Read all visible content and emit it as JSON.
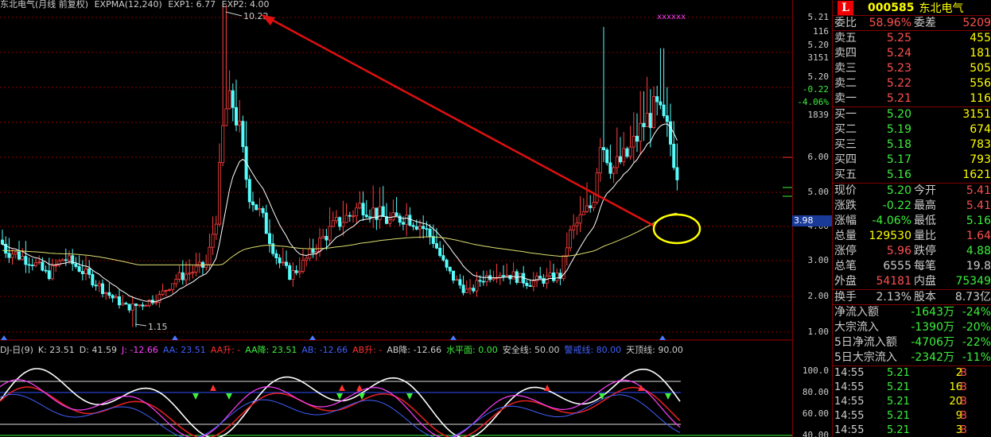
{
  "chart_header": {
    "stock": "东北电气(月线 前复权)",
    "expma": "EXPMA(12,240)",
    "exp1": "EXP1: 6.77",
    "exp2": "EXP2: 4.00"
  },
  "annotations": {
    "high_label": "10.22",
    "low_label": "1.15"
  },
  "indicator_legend": [
    {
      "text": "DJ-日(9)",
      "color": "#cccccc"
    },
    {
      "text": "K: 23.51",
      "color": "#cccccc"
    },
    {
      "text": "D: 41.59",
      "color": "#cccccc"
    },
    {
      "text": "J: -12.66",
      "color": "#ff40ff"
    },
    {
      "text": "AA: 23.51",
      "color": "#4060ff"
    },
    {
      "text": "AA升: -",
      "color": "#ff3030"
    },
    {
      "text": "AA降: 23.51",
      "color": "#3cf03c"
    },
    {
      "text": "AB: -12.66",
      "color": "#4060ff"
    },
    {
      "text": "AB升: -",
      "color": "#ff3030"
    },
    {
      "text": "AB降: -12.66",
      "color": "#cccccc"
    },
    {
      "text": "水平面: 0.00",
      "color": "#3cf03c"
    },
    {
      "text": "安全线: 50.00",
      "color": "#cccccc"
    },
    {
      "text": "警戒线: 80.00",
      "color": "#4060ff"
    },
    {
      "text": "天顶线: 90.00",
      "color": "#cccccc"
    }
  ],
  "price_axis": {
    "ticks": [
      "6.00",
      "5.00",
      "4.00",
      "3.00",
      "2.00",
      "1.00"
    ],
    "ind_ticks": [
      "100.0",
      "80.00",
      "60.00",
      "40.00"
    ],
    "current": "3.98",
    "top_info": [
      "5.21",
      "116",
      "5.20",
      "3151",
      "5.20",
      "-0.22",
      "-4.06%",
      "1839"
    ]
  },
  "quote": {
    "logo": "L",
    "code": "000585",
    "name": "东北电气",
    "weibi": {
      "label": "委比",
      "value": "58.96%",
      "label2": "委差",
      "value2": "5209"
    },
    "asks": [
      {
        "label": "卖五",
        "price": "5.25",
        "vol": "455"
      },
      {
        "label": "卖四",
        "price": "5.24",
        "vol": "181"
      },
      {
        "label": "卖三",
        "price": "5.23",
        "vol": "505"
      },
      {
        "label": "卖二",
        "price": "5.22",
        "vol": "556"
      },
      {
        "label": "卖一",
        "price": "5.21",
        "vol": "116"
      }
    ],
    "bids": [
      {
        "label": "买一",
        "price": "5.20",
        "vol": "3151"
      },
      {
        "label": "买二",
        "price": "5.19",
        "vol": "674"
      },
      {
        "label": "买三",
        "price": "5.18",
        "vol": "783"
      },
      {
        "label": "买四",
        "price": "5.17",
        "vol": "793"
      },
      {
        "label": "买五",
        "price": "5.16",
        "vol": "1621"
      }
    ],
    "stats": [
      {
        "l": "现价",
        "v": "5.20",
        "vc": "green",
        "l2": "今开",
        "v2": "5.41",
        "v2c": "red"
      },
      {
        "l": "涨跌",
        "v": "-0.22",
        "vc": "green",
        "l2": "最高",
        "v2": "5.41",
        "v2c": "red"
      },
      {
        "l": "涨幅",
        "v": "-4.06%",
        "vc": "green",
        "l2": "最低",
        "v2": "5.16",
        "v2c": "green"
      },
      {
        "l": "总量",
        "v": "129530",
        "vc": "yellow",
        "l2": "量比",
        "v2": "1.64",
        "v2c": "red"
      },
      {
        "l": "涨停",
        "v": "5.96",
        "vc": "red",
        "l2": "跌停",
        "v2": "4.88",
        "v2c": "green"
      },
      {
        "l": "总笔",
        "v": "6555",
        "vc": "white",
        "l2": "每笔",
        "v2": "19.8",
        "v2c": "white"
      },
      {
        "l": "外盘",
        "v": "54181",
        "vc": "red",
        "l2": "内盘",
        "v2": "75349",
        "v2c": "green"
      }
    ],
    "turnover": {
      "l": "换手",
      "v": "2.13%",
      "l2": "股本",
      "v2": "8.73亿"
    },
    "flows": [
      {
        "l": "净流入额",
        "v": "-1643万",
        "p": "-24%"
      },
      {
        "l": "大宗流入",
        "v": "-1390万",
        "p": "-20%"
      },
      {
        "l": "5日净流入额",
        "v": "-4706万",
        "p": "-22%"
      },
      {
        "l": "5日大宗流入",
        "v": "-2342万",
        "p": "-11%"
      }
    ],
    "trades": [
      {
        "t": "14:55",
        "p": "5.21",
        "n": "2",
        "b": "B"
      },
      {
        "t": "14:55",
        "p": "5.21",
        "n": "16",
        "b": "B"
      },
      {
        "t": "14:55",
        "p": "5.21",
        "n": "20",
        "b": "B"
      },
      {
        "t": "14:55",
        "p": "5.21",
        "n": "9",
        "b": "B"
      },
      {
        "t": "14:55",
        "p": "5.21",
        "n": "3",
        "b": "B"
      }
    ]
  },
  "colors": {
    "up": "#ff4040",
    "down": "#54fcfc",
    "exp1": "#ffffff",
    "exp2": "#e0e070",
    "arrow": "#e01010",
    "circle": "#ffff00"
  }
}
